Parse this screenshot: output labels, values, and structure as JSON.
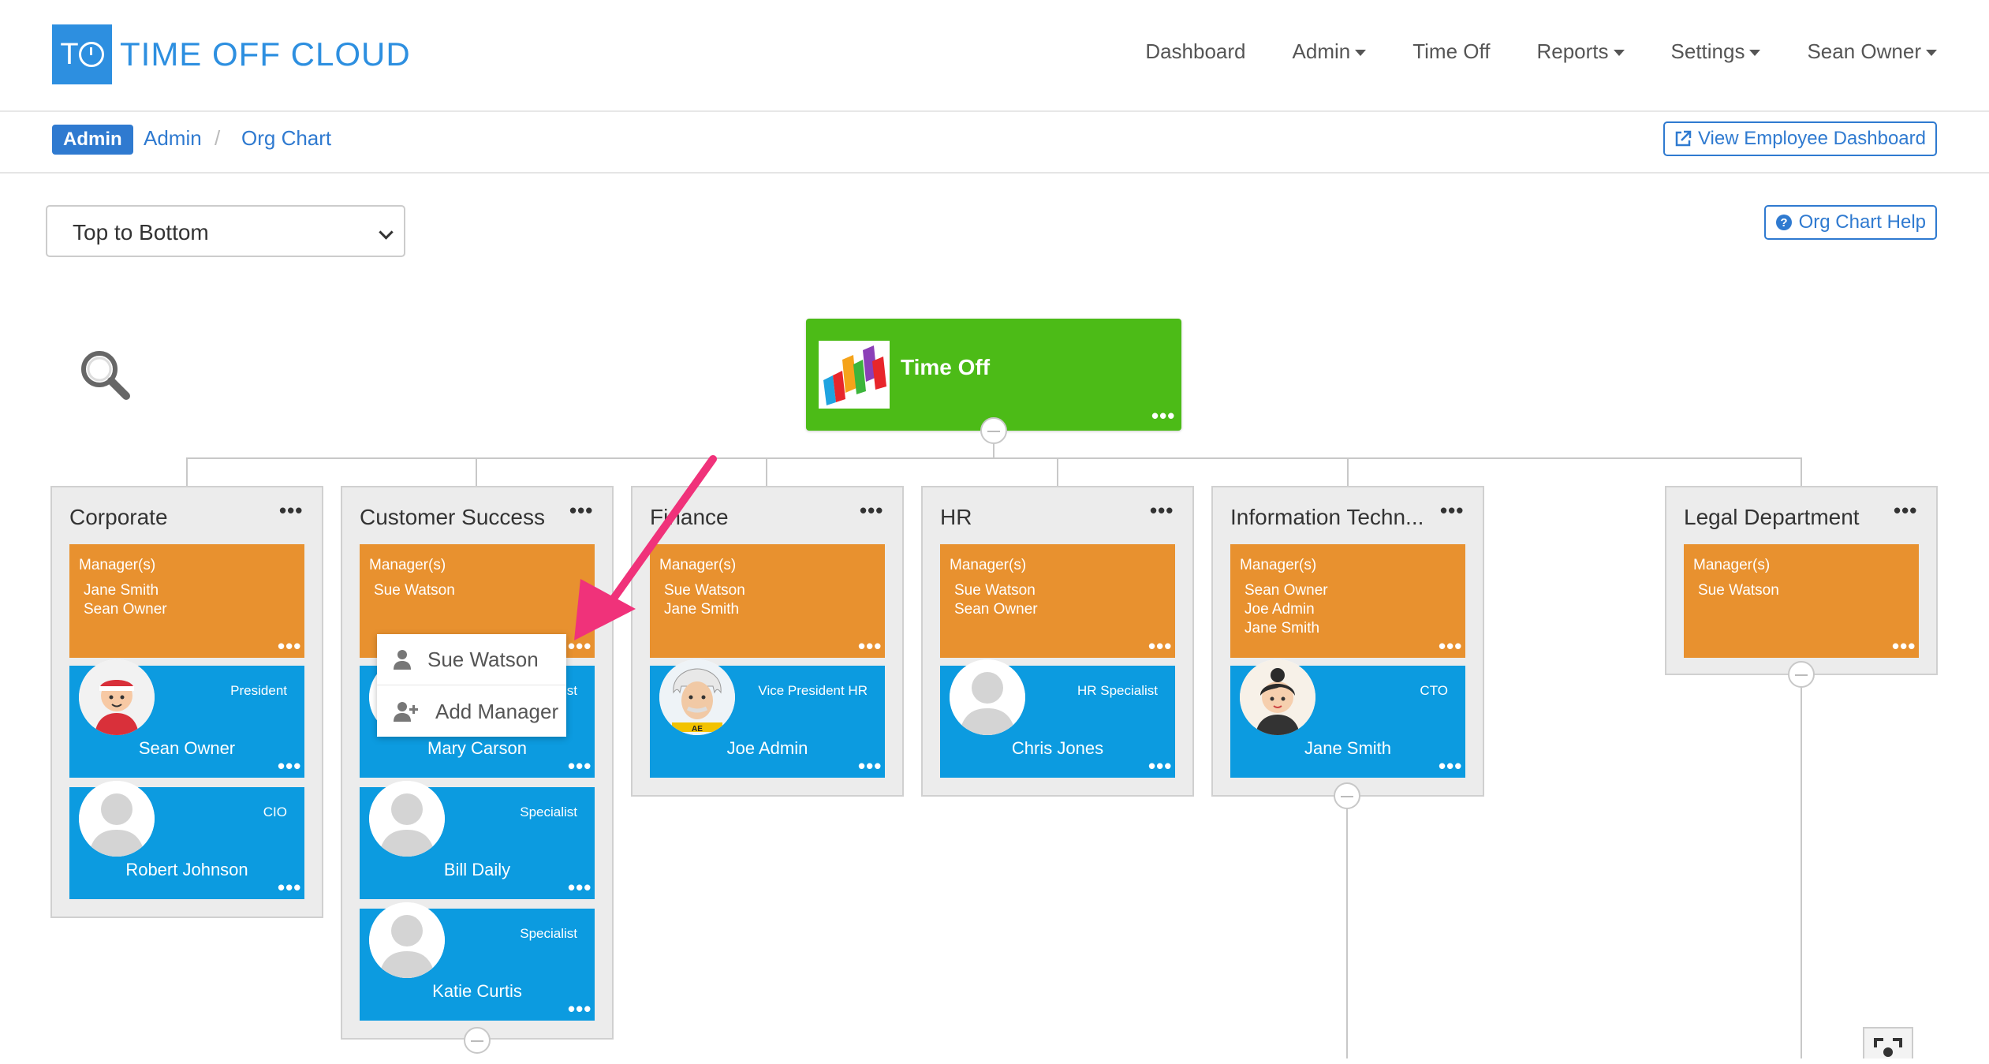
{
  "app": {
    "logo_text": "TIME OFF CLOUD",
    "logo_mark": "TO"
  },
  "nav": {
    "items": [
      {
        "label": "Dashboard",
        "dropdown": false
      },
      {
        "label": "Admin",
        "dropdown": true
      },
      {
        "label": "Time Off",
        "dropdown": false
      },
      {
        "label": "Reports",
        "dropdown": true
      },
      {
        "label": "Settings",
        "dropdown": true
      },
      {
        "label": "Sean Owner",
        "dropdown": true
      }
    ]
  },
  "breadcrumb": {
    "badge": "Admin",
    "items": [
      "Admin",
      "Org Chart"
    ],
    "separator": "/",
    "view_dashboard_label": "View Employee Dashboard"
  },
  "controls": {
    "orientation_value": "Top to Bottom",
    "help_label": "Org Chart Help"
  },
  "org": {
    "root": {
      "title": "Time Off"
    },
    "departments": [
      {
        "name": "Corporate",
        "manager_label": "Manager(s)",
        "managers": [
          "Jane Smith",
          "Sean Owner"
        ],
        "employees": [
          {
            "name": "Sean Owner",
            "role": "President",
            "avatar": "cartoon-man"
          },
          {
            "name": "Robert Johnson",
            "role": "CIO",
            "avatar": "placeholder"
          }
        ]
      },
      {
        "name": "Customer Success",
        "manager_label": "Manager(s)",
        "managers": [
          "Sue Watson"
        ],
        "employees": [
          {
            "name": "Mary Carson",
            "role": "Specialist",
            "avatar": "placeholder"
          },
          {
            "name": "Bill Daily",
            "role": "Specialist",
            "avatar": "placeholder"
          },
          {
            "name": "Katie Curtis",
            "role": "Specialist",
            "avatar": "placeholder"
          }
        ]
      },
      {
        "name": "Finance",
        "manager_label": "Manager(s)",
        "managers": [
          "Sue Watson",
          "Jane Smith"
        ],
        "employees": [
          {
            "name": "Joe Admin",
            "role": "Vice President HR",
            "avatar": "einstein"
          }
        ]
      },
      {
        "name": "HR",
        "manager_label": "Manager(s)",
        "managers": [
          "Sue Watson",
          "Sean Owner"
        ],
        "employees": [
          {
            "name": "Chris Jones",
            "role": "HR Specialist",
            "avatar": "placeholder"
          }
        ]
      },
      {
        "name": "Information Techn...",
        "manager_label": "Manager(s)",
        "managers": [
          "Sean Owner",
          "Joe Admin",
          "Jane Smith"
        ],
        "employees": [
          {
            "name": "Jane Smith",
            "role": "CTO",
            "avatar": "cartoon-woman"
          }
        ]
      },
      {
        "name": "Legal Department",
        "manager_label": "Manager(s)",
        "managers": [
          "Sue Watson"
        ],
        "employees": []
      }
    ]
  },
  "popup_menu": {
    "items": [
      {
        "label": "Sue Watson",
        "icon": "user-icon"
      },
      {
        "label": "Add Manager",
        "icon": "user-plus-icon"
      }
    ]
  },
  "colors": {
    "brand_blue": "#2d8fe0",
    "link_blue": "#2f7ad0",
    "root_green": "#4cbb17",
    "manager_orange": "#e8912f",
    "employee_blue": "#0c9be0",
    "annotation_pink": "#f0327a"
  }
}
